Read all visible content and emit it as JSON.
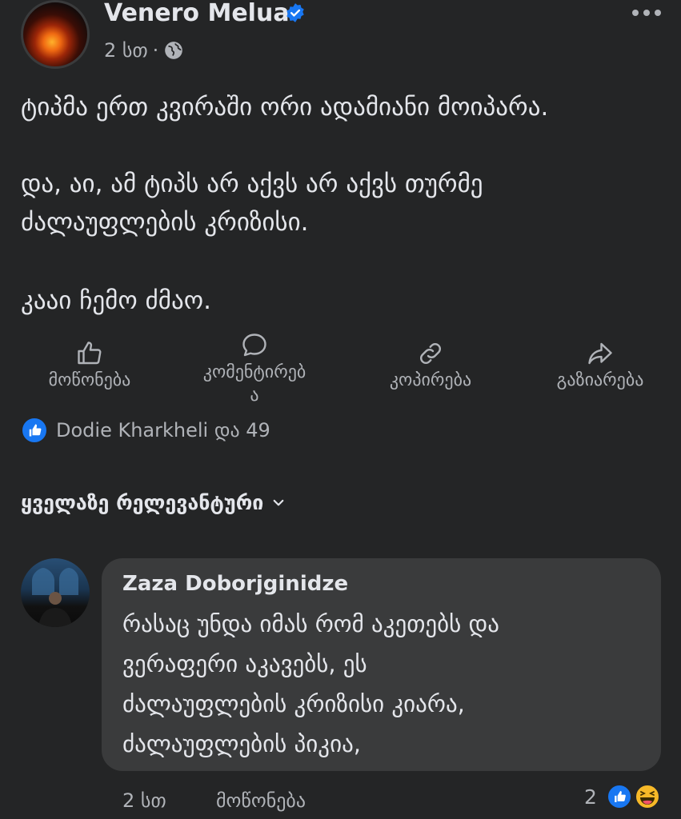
{
  "post": {
    "author": "Venero Melua",
    "time": "2 სთ",
    "separator": "·",
    "lines": [
      "ტიპმა ერთ კვირაში ორი ადამიანი მოიპარა.",
      "და, აი, ამ ტიპს არ აქვს არ აქვს თურმე",
      "ძალაუფლების კრიზისი.",
      "კააი ჩემო ძმაო."
    ]
  },
  "actions": [
    {
      "label": "მოწონება",
      "icon": "like-icon"
    },
    {
      "label": "კომენტირებ",
      "label2": "ა",
      "icon": "comment-icon"
    },
    {
      "label": "კოპირება",
      "icon": "link-icon"
    },
    {
      "label": "გაზიარება",
      "icon": "share-icon"
    }
  ],
  "reactions": {
    "text": "Dodie Kharkheli და 49"
  },
  "sort": {
    "label": "ყველაზე რელევანტური"
  },
  "comment": {
    "author": "Zaza Doborjginidze",
    "lines": [
      "რასაც უნდა იმას რომ აკეთებს და",
      "ვერაფერი აკავებს, ეს",
      "ძალაუფლების კრიზისი კიარა,",
      "ძალაუფლების პიკია,"
    ],
    "time": "2 სთ",
    "like_label": "მოწონება",
    "reaction_count": "2"
  },
  "colors": {
    "background": "#242526",
    "bubble": "#3a3b3c",
    "accent": "#1877f2",
    "secondary_text": "#b0b3b8"
  }
}
